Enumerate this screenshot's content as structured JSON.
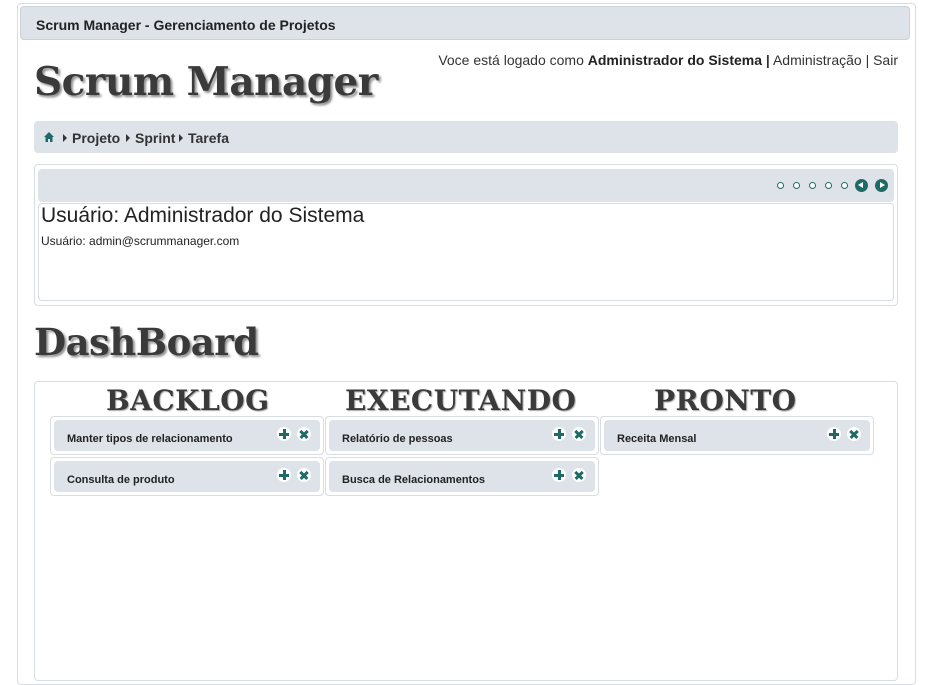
{
  "header": {
    "app_title": "Scrum Manager - Gerenciamento de Projetos",
    "logo": "Scrum Manager",
    "logged_prefix": "Voce está logado como",
    "user_name": "Administrador do Sistema",
    "separator": "|",
    "admin_link": "Administração",
    "logout_link": "Sair"
  },
  "breadcrumb": {
    "home_icon": "home-icon",
    "items": [
      "Projeto",
      "Sprint",
      "Tarefa"
    ]
  },
  "profile": {
    "title": "Usuário: Administrador do Sistema",
    "detail": "Usuário: admin@scrummanager.com"
  },
  "dashboard": {
    "title": "DashBoard",
    "columns": [
      {
        "title": "BACKLOG",
        "cards": [
          "Manter tipos de relacionamento",
          "Consulta de produto"
        ]
      },
      {
        "title": "EXECUTANDO",
        "cards": [
          "Relatório de pessoas",
          "Busca de Relacionamentos"
        ]
      },
      {
        "title": "PRONTO",
        "cards": [
          "Receita Mensal"
        ]
      }
    ]
  },
  "colors": {
    "accent": "#1f6a66",
    "bar_bg": "#dde3e9",
    "border": "#d7dde3"
  }
}
